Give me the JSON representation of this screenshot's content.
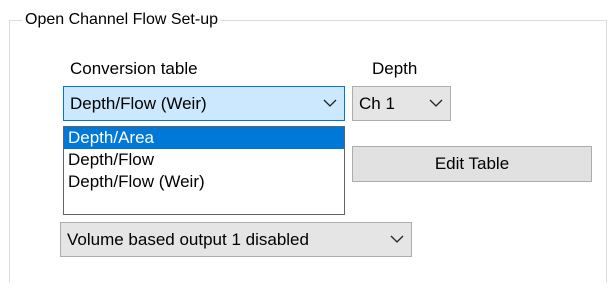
{
  "groupbox": {
    "title": "Open Channel Flow Set-up"
  },
  "conversion": {
    "label": "Conversion table",
    "selected": "Depth/Flow (Weir)",
    "options": [
      "Depth/Area",
      "Depth/Flow",
      "Depth/Flow (Weir)"
    ],
    "highlighted": "Depth/Area"
  },
  "depth": {
    "label": "Depth",
    "selected": "Ch 1"
  },
  "edit_table": {
    "label": "Edit Table"
  },
  "volume_output": {
    "selected": "Volume based output 1 disabled"
  },
  "icons": {
    "dropdown_arrow": "chevron-down-icon"
  },
  "colors": {
    "focus_border": "#0078d7",
    "focus_fill": "#cce8ff",
    "selection": "#0078d7"
  }
}
